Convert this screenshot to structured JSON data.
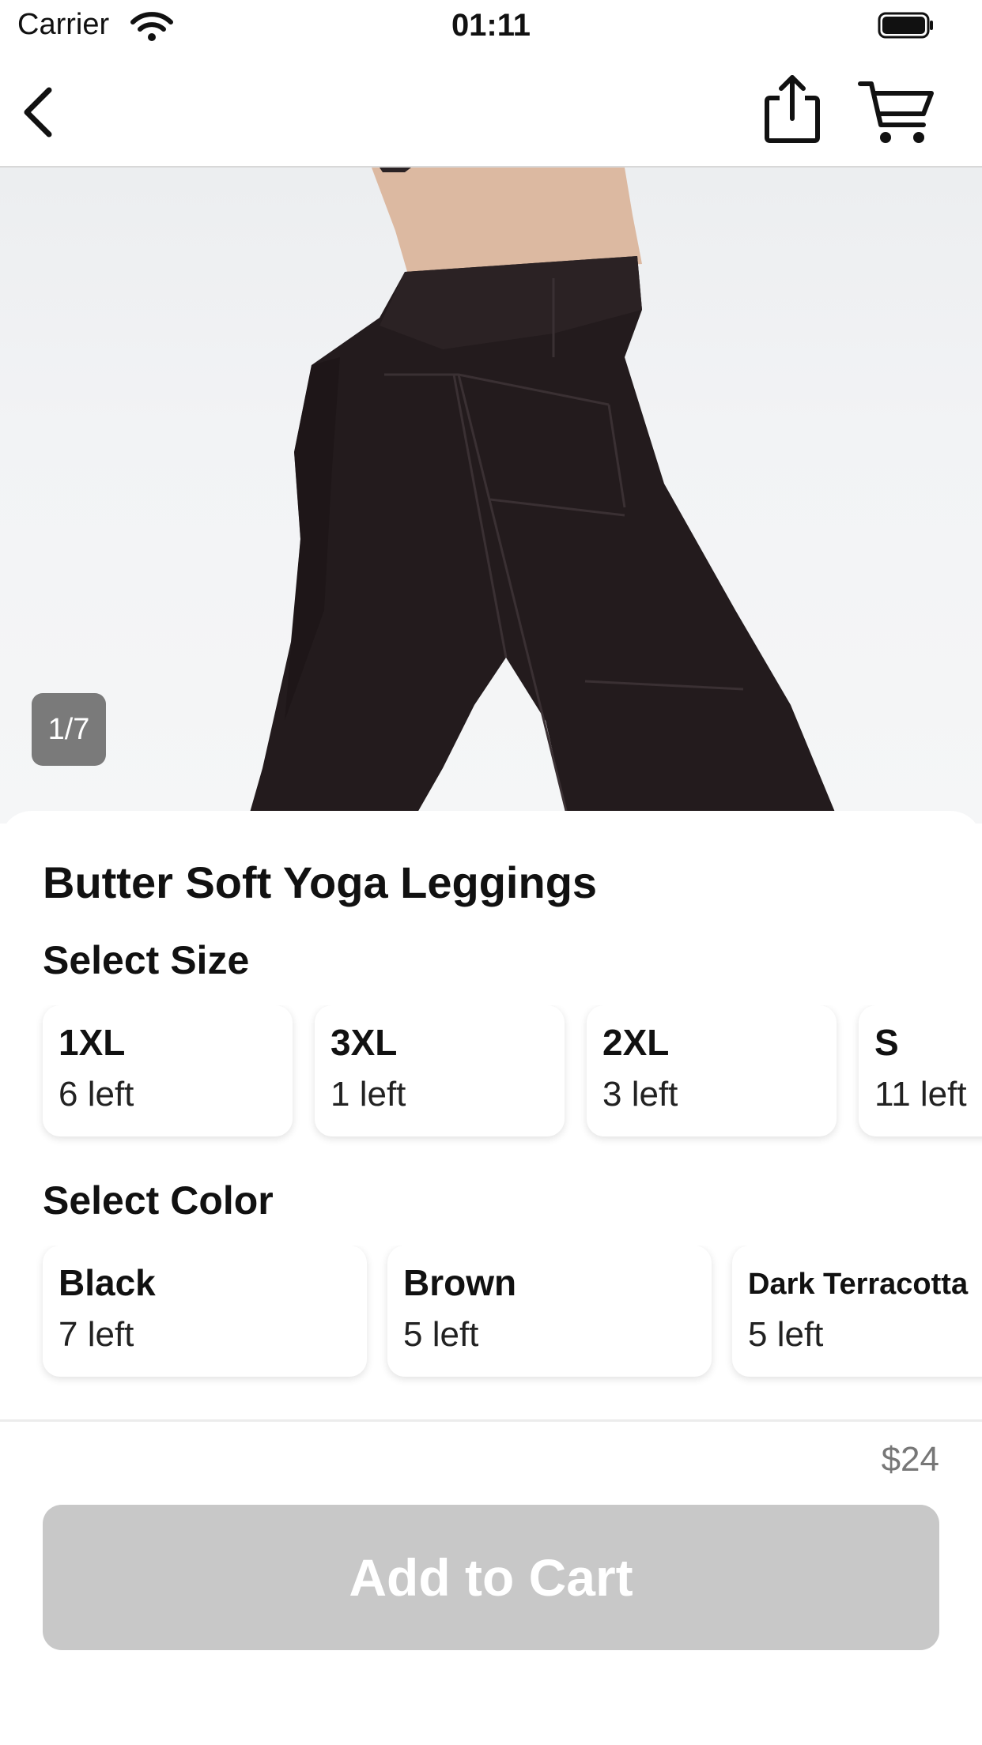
{
  "status_bar": {
    "carrier": "Carrier",
    "time": "01:11"
  },
  "nav": {
    "back_icon": "chevron-left-icon",
    "share_icon": "share-icon",
    "cart_icon": "cart-icon"
  },
  "gallery": {
    "page_indicator": "1/7"
  },
  "product": {
    "title": "Butter Soft Yoga Leggings",
    "price": "$24"
  },
  "size_section": {
    "title": "Select Size",
    "options": [
      {
        "name": "1XL",
        "stock": "6 left"
      },
      {
        "name": "3XL",
        "stock": "1 left"
      },
      {
        "name": "2XL",
        "stock": "3 left"
      },
      {
        "name": "S",
        "stock": "11 left"
      }
    ]
  },
  "color_section": {
    "title": "Select Color",
    "options": [
      {
        "name": "Black",
        "stock": "7 left"
      },
      {
        "name": "Brown",
        "stock": "5 left"
      },
      {
        "name": "Dark Terracotta",
        "stock": "5 left"
      }
    ]
  },
  "actions": {
    "add_to_cart": "Add to Cart"
  },
  "colors": {
    "button_disabled": "#c8c8c8",
    "badge_background": "#7a7a7a",
    "leggings": "#231b1d"
  }
}
